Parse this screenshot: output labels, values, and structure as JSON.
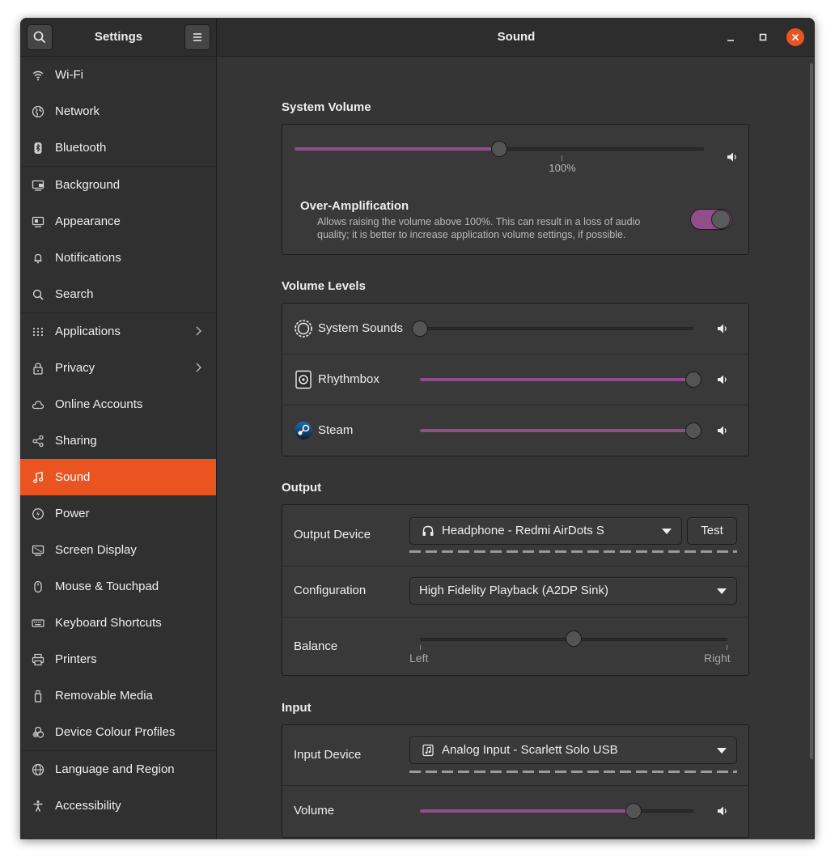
{
  "window": {
    "sidebar_title": "Settings",
    "page_title": "Sound"
  },
  "sidebar": {
    "items": [
      {
        "label": "Wi-Fi",
        "icon": "wifi-icon"
      },
      {
        "label": "Network",
        "icon": "globe-icon"
      },
      {
        "label": "Bluetooth",
        "icon": "bluetooth-icon"
      },
      {
        "label": "Background",
        "icon": "background-icon"
      },
      {
        "label": "Appearance",
        "icon": "appearance-icon"
      },
      {
        "label": "Notifications",
        "icon": "bell-icon"
      },
      {
        "label": "Search",
        "icon": "search-icon"
      },
      {
        "label": "Applications",
        "icon": "grid-icon"
      },
      {
        "label": "Privacy",
        "icon": "lock-icon"
      },
      {
        "label": "Online Accounts",
        "icon": "cloud-icon"
      },
      {
        "label": "Sharing",
        "icon": "share-icon"
      },
      {
        "label": "Sound",
        "icon": "music-note-icon",
        "active": true
      },
      {
        "label": "Power",
        "icon": "power-icon"
      },
      {
        "label": "Screen Display",
        "icon": "display-icon"
      },
      {
        "label": "Mouse & Touchpad",
        "icon": "mouse-icon"
      },
      {
        "label": "Keyboard Shortcuts",
        "icon": "keyboard-icon"
      },
      {
        "label": "Printers",
        "icon": "printer-icon"
      },
      {
        "label": "Removable Media",
        "icon": "usb-icon"
      },
      {
        "label": "Device Colour Profiles",
        "icon": "color-profile-icon"
      },
      {
        "label": "Language and Region",
        "icon": "language-icon"
      },
      {
        "label": "Accessibility",
        "icon": "accessibility-icon"
      }
    ]
  },
  "system_volume": {
    "title": "System Volume",
    "volume_fraction": 0.5,
    "mark_label": "100%",
    "over_amplification": {
      "title": "Over-Amplification",
      "description_line1": "Allows raising the volume above 100%. This can result in a loss of audio",
      "description_line2": "quality; it is better to increase application volume settings, if possible.",
      "enabled": true
    }
  },
  "volume_levels": {
    "title": "Volume Levels",
    "apps": [
      {
        "name": "System Sounds",
        "icon": "system-sounds-icon",
        "level": 0.0
      },
      {
        "name": "Rhythmbox",
        "icon": "rhythmbox-icon",
        "level": 1.0
      },
      {
        "name": "Steam",
        "icon": "steam-icon",
        "level": 1.0
      }
    ]
  },
  "output": {
    "title": "Output",
    "device_label": "Output Device",
    "device_value": "Headphone - Redmi AirDots S",
    "test_label": "Test",
    "configuration_label": "Configuration",
    "configuration_value": "High Fidelity Playback (A2DP Sink)",
    "balance_label": "Balance",
    "balance_left": "Left",
    "balance_right": "Right",
    "balance_fraction": 0.5
  },
  "input": {
    "title": "Input",
    "device_label": "Input Device",
    "device_value": "Analog Input - Scarlett Solo USB",
    "volume_label": "Volume",
    "volume_fraction": 0.78
  },
  "colors": {
    "accent": "#e95420",
    "slider_fill": "#924d8b",
    "close_button": "#e95420"
  }
}
